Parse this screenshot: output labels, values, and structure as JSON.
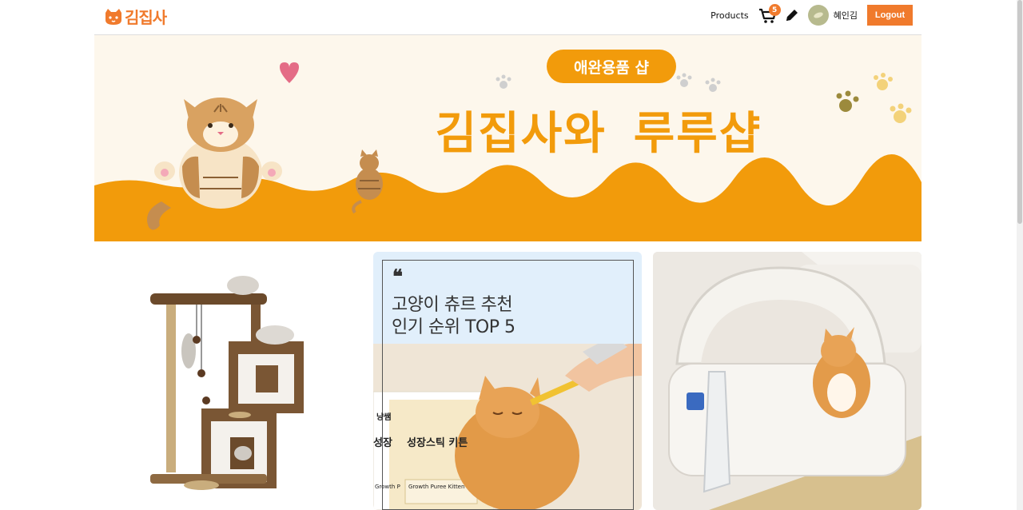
{
  "header": {
    "logo_text": "김집사",
    "nav_products": "Products",
    "cart_count": "5",
    "username": "혜인김",
    "logout_label": "Logout"
  },
  "banner": {
    "pill_text": "애완용품 샵",
    "title_left": "김집사와",
    "title_right": "루루샵"
  },
  "cards": {
    "card2": {
      "quote_mark": "❝",
      "line1": "고양이 츄르 추천",
      "line2": "인기 순위 TOP 5",
      "pkg_text": "성장스틱 키튼",
      "pkg_side": "성장",
      "pkg_brand": "냥쌤",
      "pkg_small": "Growth Puree Kitten",
      "pkg_small2": "Growth P"
    }
  },
  "colors": {
    "accent": "#f07a2c",
    "banner_orange": "#f29b0b",
    "banner_bg": "#fdf7ec"
  }
}
